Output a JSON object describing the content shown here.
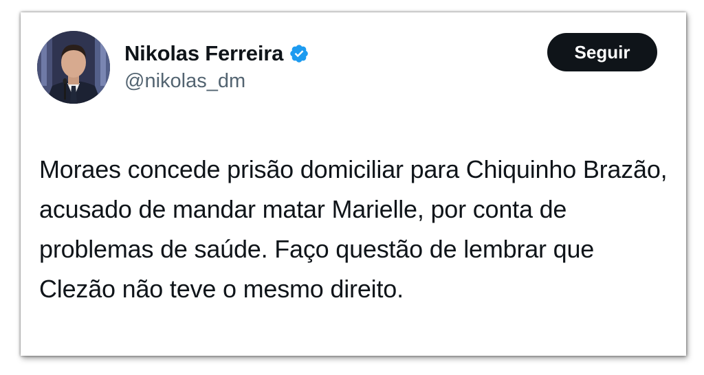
{
  "tweet": {
    "author": {
      "name": "Nikolas Ferreira",
      "handle": "@nikolas_dm",
      "verified": true,
      "verified_color": "#1d9bf0"
    },
    "follow_label": "Seguir",
    "text": "Moraes concede prisão domiciliar para Chiquinho Brazão, acusado de mandar matar Marielle, por conta de problemas de saúde. Faço questão de lembrar que Clezão não teve o mesmo direito."
  },
  "icons": {
    "avatar": "profile-photo",
    "verified": "verified-badge-icon"
  }
}
